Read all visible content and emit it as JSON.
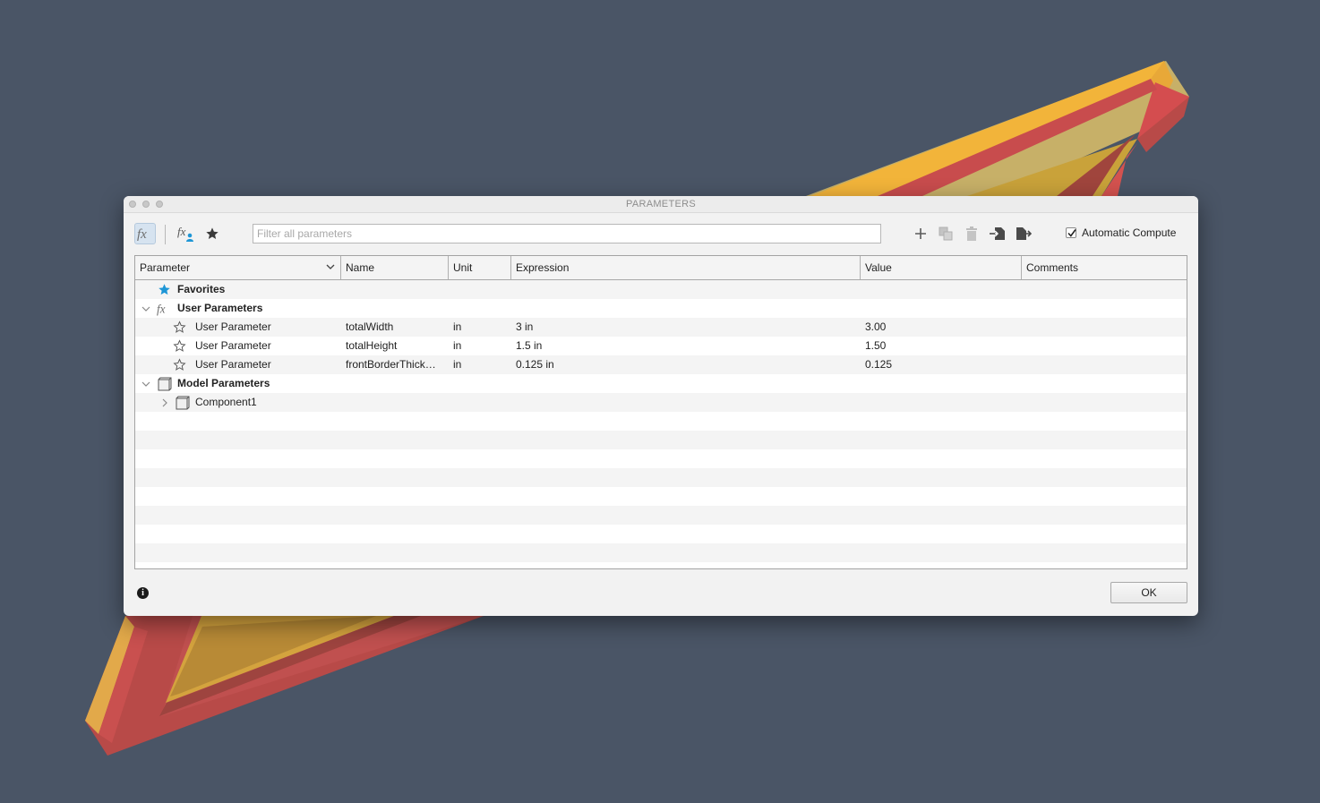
{
  "dialog": {
    "title": "PARAMETERS"
  },
  "toolbar": {
    "filter_placeholder": "Filter all parameters",
    "automatic_compute_label": "Automatic Compute",
    "automatic_compute_checked": true
  },
  "table": {
    "columns": [
      "Parameter",
      "Name",
      "Unit",
      "Expression",
      "Value",
      "Comments"
    ],
    "groups": {
      "favorites": "Favorites",
      "user_parameters": "User Parameters",
      "model_parameters": "Model Parameters"
    },
    "user_parameters": [
      {
        "type": "User Parameter",
        "name": "totalWidth",
        "unit": "in",
        "expression": "3 in",
        "value": "3.00",
        "comment": ""
      },
      {
        "type": "User Parameter",
        "name": "totalHeight",
        "unit": "in",
        "expression": "1.5 in",
        "value": "1.50",
        "comment": ""
      },
      {
        "type": "User Parameter",
        "name": "frontBorderThick…",
        "unit": "in",
        "expression": "0.125 in",
        "value": "0.125",
        "comment": ""
      }
    ],
    "model_components": [
      {
        "label": "Component1"
      }
    ]
  },
  "footer": {
    "ok_label": "OK",
    "info_glyph": "i"
  },
  "colors": {
    "background": "#4a5566",
    "frame_red": "#c0504f",
    "frame_yellow": "#d9a540",
    "favorite_star": "#1e96d6",
    "selected_tool": "#d6e3f0"
  }
}
